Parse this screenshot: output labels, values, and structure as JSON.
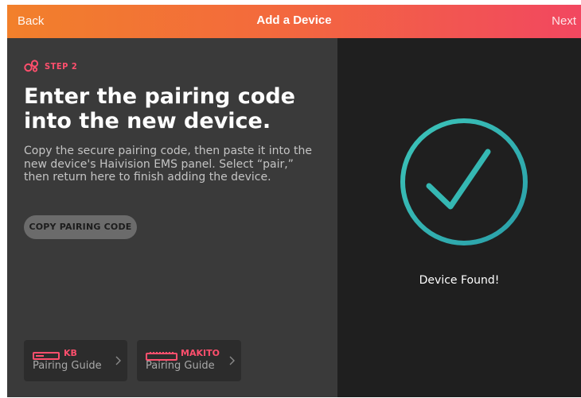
{
  "header": {
    "back_label": "Back",
    "title": "Add a Device",
    "next_label": "Next"
  },
  "step": {
    "label": "STEP 2",
    "icon": "pairing-rings-icon"
  },
  "main": {
    "heading": "Enter the pairing code into the new device.",
    "instructions": "Copy the secure pairing code, then paste it into the new device's Haivision EMS panel. Select “pair,” then return here to finish adding the device.",
    "copy_button_label": "COPY PAIRING CODE"
  },
  "guides": [
    {
      "model": "KB",
      "label": "Pairing Guide",
      "icon": "kb-device-icon"
    },
    {
      "model": "MAKITO",
      "label": "Pairing Guide",
      "icon": "makito-device-icon"
    }
  ],
  "status": {
    "text": "Device Found!",
    "icon": "checkmark-circle-icon"
  },
  "colors": {
    "header_gradient_start": "#f2802b",
    "header_gradient_end": "#f24760",
    "accent": "#ff4f6d",
    "check_teal": "#35b8b3"
  }
}
